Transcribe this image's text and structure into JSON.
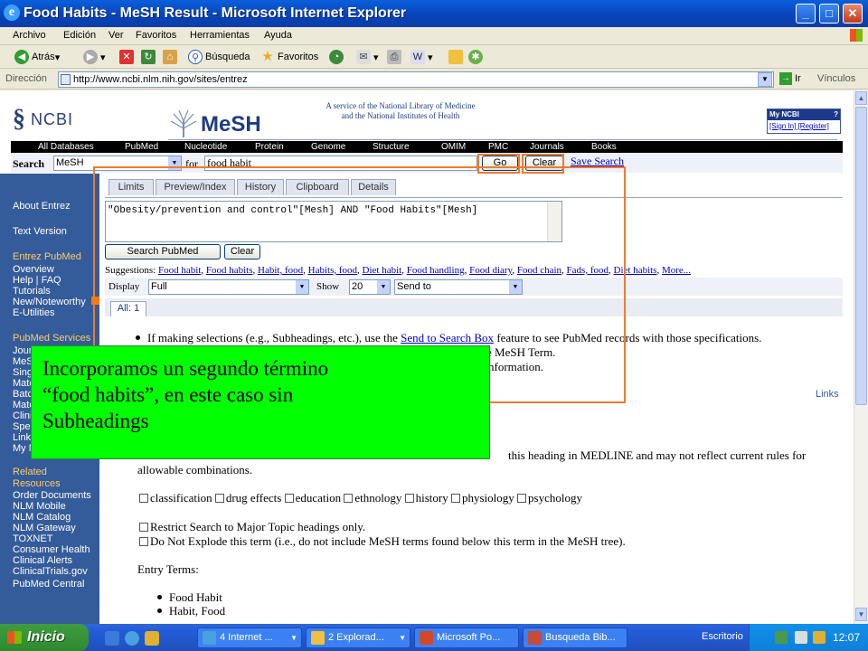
{
  "window": {
    "title": "Food Habits - MeSH Result - Microsoft Internet Explorer"
  },
  "menu": [
    "Archivo",
    "Edición",
    "Ver",
    "Favoritos",
    "Herramientas",
    "Ayuda"
  ],
  "toolbar": {
    "back": "Atrás",
    "search": "Búsqueda",
    "favorites": "Favoritos"
  },
  "address": {
    "label": "Dirección",
    "url": "http://www.ncbi.nlm.nih.gov/sites/entrez",
    "go": "Ir",
    "links": "Vínculos"
  },
  "header": {
    "ncbi": "NCBI",
    "mesh": "MeSH",
    "service_line1": "A service of the National Library of Medicine",
    "service_line2": "and the National Institutes of Health",
    "myncbi": "My NCBI",
    "myncbi_q": "?",
    "signin": "[Sign In] [Register]"
  },
  "db_tabs": [
    "All Databases",
    "PubMed",
    "Nucleotide",
    "Protein",
    "Genome",
    "Structure",
    "OMIM",
    "PMC",
    "Journals",
    "Books"
  ],
  "search": {
    "label": "Search",
    "db": "MeSH",
    "for": "for",
    "query": "food habit",
    "go": "Go",
    "clear": "Clear",
    "save": "Save Search"
  },
  "left_nav": {
    "about": "About Entrez",
    "text_version": "Text Version",
    "entrez_pubmed": "Entrez PubMed",
    "pubmed_items": [
      "Overview",
      "Help | FAQ",
      "Tutorials",
      "New/Noteworthy",
      "E-Utilities"
    ],
    "pubmed_services": "PubMed Services",
    "services_items": [
      "Jour",
      "MeS",
      "Sing",
      "Matc",
      "Batc",
      "Matc",
      "Clini",
      "Spe",
      "Link",
      "My N"
    ],
    "related_resources_1": "Related",
    "related_resources_2": "Resources",
    "related_items": [
      "Order Documents",
      "NLM Mobile",
      "NLM Catalog",
      "NLM Gateway",
      "TOXNET",
      "Consumer Health",
      "Clinical Alerts",
      "ClinicalTrials.gov",
      "PubMed Central"
    ]
  },
  "tabs": [
    "Limits",
    "Preview/Index",
    "History",
    "Clipboard",
    "Details"
  ],
  "query_box": "\"Obesity/prevention and control\"[Mesh] AND \"Food Habits\"[Mesh]",
  "search_pubmed": "Search PubMed",
  "clear2": "Clear",
  "suggestions": {
    "label": "Suggestions:",
    "items": [
      "Food habit",
      "Food habits",
      "Habit, food",
      "Habits, food",
      "Diet habit",
      "Food handling",
      "Food diary",
      "Food chain",
      "Fads, food",
      "Diet habits",
      "More..."
    ]
  },
  "display": {
    "label": "Display",
    "value": "Full",
    "show": "Show",
    "count": "20",
    "send": "Send to"
  },
  "all_tab": "All: 1",
  "body": {
    "line1_pre": "If making selections (e.g., Subheadings, etc.), use the ",
    "line1_link": "Send to Search Box",
    "line1_post": " feature to see PubMed records with those specifications.",
    "line2_tail": "e MeSH Term.",
    "line3_tail": "nformation.",
    "links": "Links",
    "sub_line1_tail": "this heading in MEDLINE and may not reflect current rules for",
    "sub_line2": "allowable combinations.",
    "subheadings": [
      "classification",
      "drug effects",
      "education",
      "ethnology",
      "history",
      "physiology",
      "psychology"
    ],
    "restrict": "Restrict Search to Major Topic headings only.",
    "no_explode": "Do Not Explode this term (i.e., do not include MeSH terms found below this term in the MeSH tree).",
    "entry_terms": "Entry Terms:",
    "entry_items": [
      "Food Habit",
      "Habit, Food"
    ]
  },
  "callout": {
    "line1": "Incorporamos un segundo término",
    "line2": "“food habits”, en este caso sin",
    "line3": "Subheadings"
  },
  "taskbar": {
    "start": "Inicio",
    "tasks": [
      "4 Internet ...",
      "2 Explorad...",
      "Microsoft Po...",
      "Busqueda Bib..."
    ],
    "desktop": "Escritorio",
    "clock": "12:07"
  },
  "colors": {
    "highlight": "#f07a30",
    "callout": "#00ff00",
    "nav": "#345b9a"
  }
}
